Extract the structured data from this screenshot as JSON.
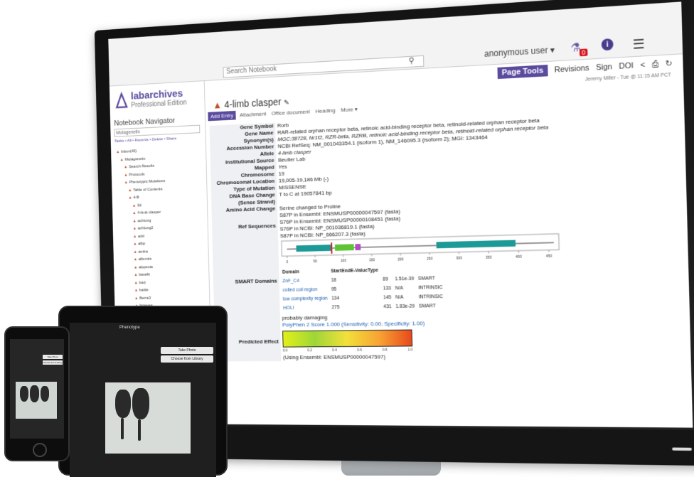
{
  "top": {
    "search_placeholder": "Search Notebook",
    "user": "anonymous user ▾",
    "badge": "0",
    "info": "i"
  },
  "sidebar": {
    "brand": "labarchives",
    "edition": "Professional Edition",
    "navigator_title": "Notebook Navigator",
    "notebook_select": "Mutagenetix",
    "links": "Tasks • All • Recents • Delete • Share",
    "tree": [
      "Inbox(43)",
      "Mutagenetix",
      "Search Results",
      "Protocols",
      "Phenotypic Mutations",
      "Table of Contents",
      "4-B",
      "3d",
      "4-limb clasper",
      "achtung",
      "achtung2",
      "add",
      "albp",
      "amba",
      "alfemtis",
      "alopecia",
      "baseltt",
      "bad",
      "battle",
      "Berra3",
      "bigeyes"
    ]
  },
  "toolbar": {
    "page_tools": "Page Tools",
    "revisions": "Revisions",
    "sign": "Sign",
    "doi": "DOI"
  },
  "page": {
    "title": "4-limb clasper",
    "meta": "Jeremy Miller - Tue @ 11:15 AM PCT",
    "add_entry": "Add Entry",
    "entry_types": [
      "Attachment",
      "Office document",
      "Heading",
      "More ▾"
    ]
  },
  "gene": {
    "rows": [
      {
        "label": "Gene Symbol",
        "value": "Rorb"
      },
      {
        "label": "Gene Name",
        "value": "RAR-related orphan receptor beta, retinoic acid-binding receptor beta, retinoid-related orphan receptor beta"
      },
      {
        "label": "Synonym(s)",
        "value": "MGC:38728, Nr1f2, RZR-beta, RZRB, retinoic acid-binding receptor beta, retinoid-related orphan receptor beta"
      },
      {
        "label": "Accession Number",
        "value": "NCBI RefSeq: NM_001043354.1 (isoform 1), NM_146095.3 (isoform 2); MGI: 1343464"
      },
      {
        "label": "Allele",
        "value": "4-limb clasper"
      },
      {
        "label": "Institutional Source",
        "value": "Beutler Lab"
      },
      {
        "label": "Mapped",
        "value": "Yes"
      },
      {
        "label": "Chromosome",
        "value": "19"
      },
      {
        "label": "Chromosomal Location",
        "value": "19,005-19,186 Mb (-)"
      },
      {
        "label": "Type of Mutation",
        "value": "MISSENSE"
      },
      {
        "label": "DNA Base Change (Sense Strand)",
        "value": "T to C at 19057841 bp"
      },
      {
        "label": "Amino Acid Change",
        "value": "Serine changed to Proline"
      }
    ],
    "ref_label": "Ref Sequences",
    "ref_lines": [
      "S87P in Ensembl: ENSMUSP00000047597 (fasta)",
      "S76P in Ensembl: ENSMUSP00000108451 (fasta)",
      "S76P in NCBI: NP_001036819.1 (fasta)",
      "S87P in NCBI: NP_666207.3 (fasta)"
    ],
    "smart_label": "SMART Domains",
    "smart_headers": [
      "Domain",
      "Start",
      "End",
      "E-Value",
      "Type"
    ],
    "smart_rows": [
      [
        "ZnF_C4",
        "18",
        "89",
        "1.51e-39",
        "SMART"
      ],
      [
        "coiled coil region",
        "95",
        "133",
        "N/A",
        "INTRINSIC"
      ],
      [
        "low complexity region",
        "134",
        "145",
        "N/A",
        "INTRINSIC"
      ],
      [
        "HOLI",
        "275",
        "431",
        "1.83e-29",
        "SMART"
      ]
    ],
    "axis_ticks": [
      "0",
      "50",
      "100",
      "150",
      "200",
      "250",
      "300",
      "350",
      "400",
      "450"
    ],
    "effect_label": "Predicted Effect",
    "probably_damaging": "probably damaging",
    "polyphen": "PolyPhen 2 Score 1.000 (Sensitivity: 0.00; Specificity: 1.00)",
    "scale_ticks": [
      "0.0",
      "0.2",
      "0.4",
      "0.6",
      "0.8",
      "1.0"
    ],
    "using": "(Using Ensembl: ENSMUSP00000047597)"
  },
  "tablet": {
    "title": "Phenotype",
    "btn1": "Take Photo",
    "btn2": "Choose from Library"
  },
  "phone": {
    "btn1": "Take Photo",
    "btn2": "Choose from Library"
  }
}
